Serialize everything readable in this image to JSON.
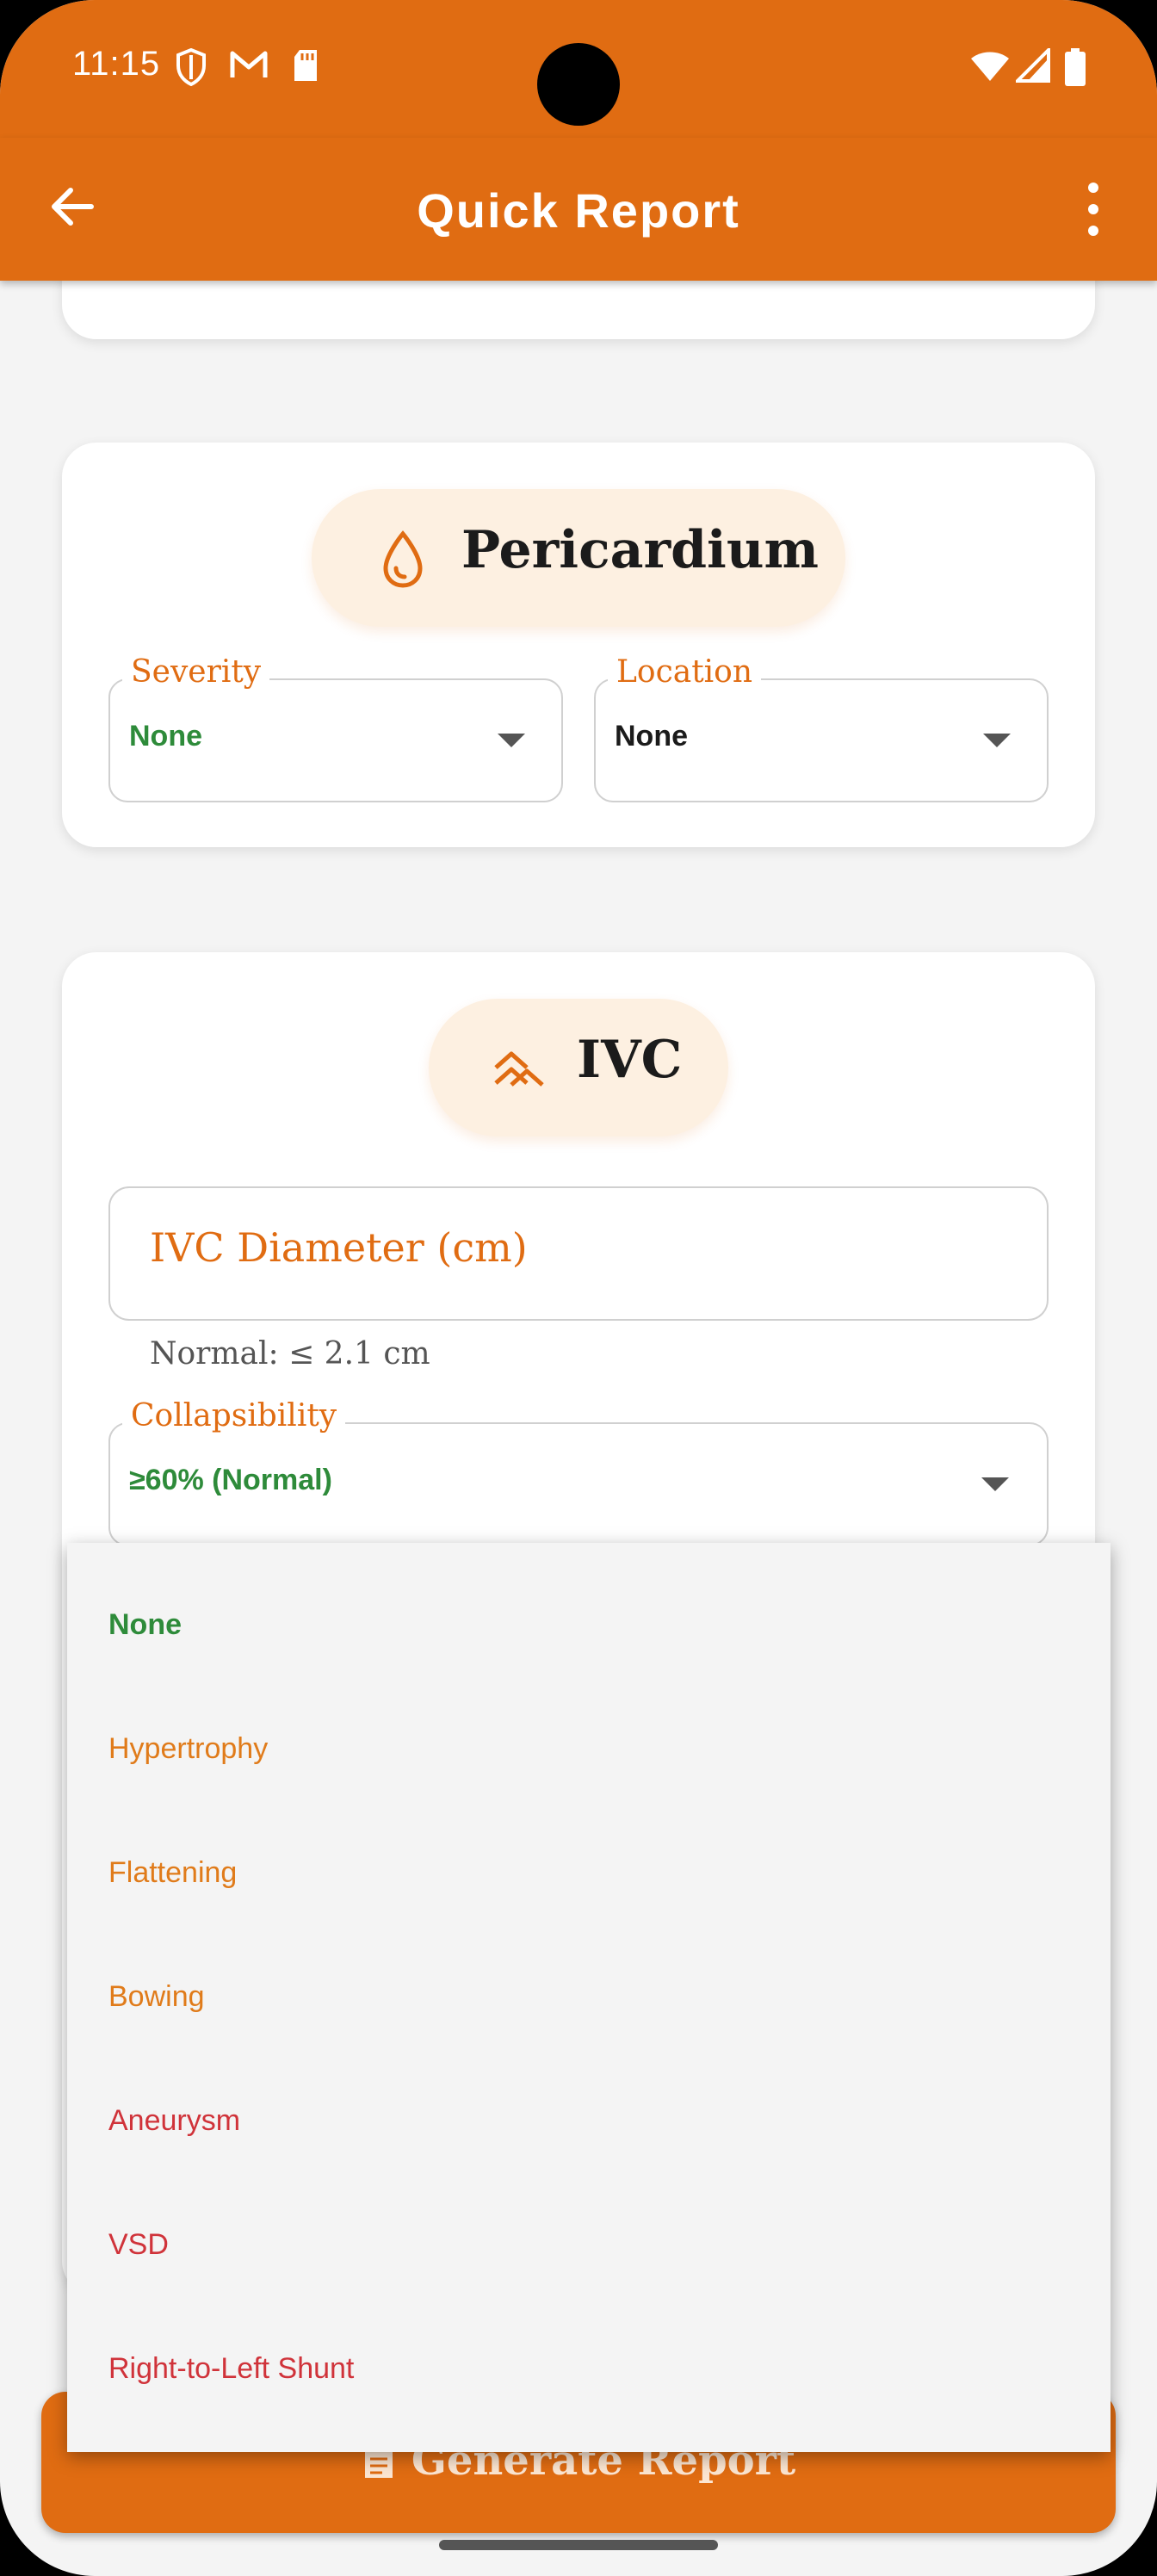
{
  "status_bar": {
    "time": "11:15"
  },
  "app_bar": {
    "title": "Quick Report"
  },
  "pericardium": {
    "title": "Pericardium",
    "severity_label": "Severity",
    "severity_value": "None",
    "location_label": "Location",
    "location_value": "None"
  },
  "ivc": {
    "title": "IVC",
    "diameter_placeholder": "IVC Diameter (cm)",
    "diameter_hint": "Normal: ≤ 2.1 cm",
    "collapsibility_label": "Collapsibility",
    "collapsibility_value": "≥60% (Normal)"
  },
  "dropdown": {
    "options": [
      {
        "label": "None",
        "color": "#2e8b3a"
      },
      {
        "label": "Hypertrophy",
        "color": "#e07b1a"
      },
      {
        "label": "Flattening",
        "color": "#e07b1a"
      },
      {
        "label": "Bowing",
        "color": "#e07b1a"
      },
      {
        "label": "Aneurysm",
        "color": "#d0333a"
      },
      {
        "label": "VSD",
        "color": "#d0333a"
      },
      {
        "label": "Right-to-Left Shunt",
        "color": "#d0333a"
      }
    ]
  },
  "footer": {
    "generate_label": "Generate Report"
  },
  "colors": {
    "accent": "#e06c12",
    "normal_green": "#2e8b3a",
    "warn_orange": "#e07b1a",
    "danger_red": "#d0333a"
  }
}
